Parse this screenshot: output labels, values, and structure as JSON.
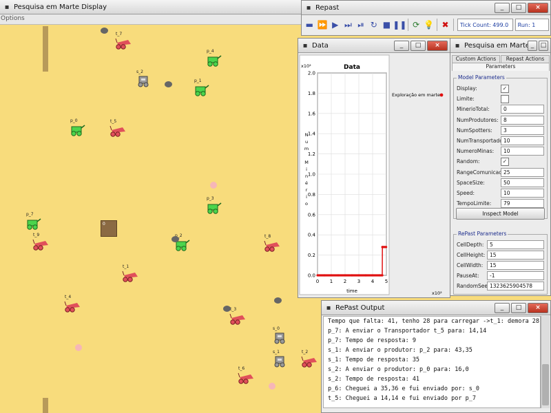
{
  "display": {
    "title": "Pesquisa em Marte Display",
    "menu_options": "Options",
    "agents": [
      {
        "label": "t_7",
        "kind": "transporter"
      },
      {
        "label": "s_2",
        "kind": "spotter"
      },
      {
        "label": "p_4",
        "kind": "producer"
      },
      {
        "label": "p_1",
        "kind": "producer"
      },
      {
        "label": "p_0",
        "kind": "producer"
      },
      {
        "label": "t_5",
        "kind": "transporter"
      },
      {
        "label": "p_3",
        "kind": "producer"
      },
      {
        "label": "p_7",
        "kind": "producer"
      },
      {
        "label": "t_9",
        "kind": "transporter"
      },
      {
        "label": "p_2",
        "kind": "producer"
      },
      {
        "label": "t_8",
        "kind": "transporter"
      },
      {
        "label": "t_1",
        "kind": "transporter"
      },
      {
        "label": "t_4",
        "kind": "transporter"
      },
      {
        "label": "t_3",
        "kind": "transporter"
      },
      {
        "label": "s_0",
        "kind": "spotter"
      },
      {
        "label": "s_1",
        "kind": "spotter"
      },
      {
        "label": "t_2",
        "kind": "transporter"
      },
      {
        "label": "t_6",
        "kind": "transporter"
      }
    ],
    "mine_label": "0"
  },
  "repast": {
    "title": "Repast",
    "tick_count": "Tick Count: 499.0",
    "run": "Run: 1"
  },
  "chart_window": {
    "title": "Data"
  },
  "chart_data": {
    "type": "line",
    "title": "Data",
    "xlabel": "time",
    "ylabel": "Num Minério",
    "x_multiplier": "x10²",
    "y_multiplier": "x10²",
    "xlim": [
      0,
      5
    ],
    "ylim": [
      0,
      2.0
    ],
    "x_ticks": [
      "0",
      "1",
      "2",
      "3",
      "4",
      "5"
    ],
    "y_ticks": [
      "0.0",
      "0.2",
      "0.4",
      "0.6",
      "0.8",
      "1.0",
      "1.2",
      "1.4",
      "1.6",
      "1.8",
      "2.0"
    ],
    "series": [
      {
        "name": "Exploração em marte",
        "color": "#e01010",
        "x": [
          0,
          0.5,
          1.0,
          1.5,
          2.0,
          2.5,
          3.0,
          3.5,
          4.0,
          4.5,
          4.7,
          4.71,
          4.98
        ],
        "y": [
          0,
          0,
          0,
          0,
          0,
          0,
          0,
          0,
          0,
          0,
          0,
          0.28,
          0.28
        ]
      }
    ]
  },
  "params_window": {
    "title": "Pesquisa em Marte",
    "tab_custom": "Custom Actions",
    "tab_repast": "Repast Actions",
    "tab_parameters": "Parameters",
    "model_group": "Model Parameters",
    "model_params": [
      {
        "label": "Display:",
        "type": "check",
        "value": "✓"
      },
      {
        "label": "Limite:",
        "type": "check",
        "value": ""
      },
      {
        "label": "MinerioTotal:",
        "type": "text",
        "value": "0"
      },
      {
        "label": "NumProdutores:",
        "type": "text",
        "value": "8"
      },
      {
        "label": "NumSpotters:",
        "type": "text",
        "value": "3"
      },
      {
        "label": "NumTransportadores:",
        "type": "text",
        "value": "10"
      },
      {
        "label": "NumeroMinas:",
        "type": "text",
        "value": "10"
      },
      {
        "label": "Random:",
        "type": "check",
        "value": "✓"
      },
      {
        "label": "RangeComunicacao:",
        "type": "text",
        "value": "25"
      },
      {
        "label": "SpaceSize:",
        "type": "text",
        "value": "50"
      },
      {
        "label": "Speed:",
        "type": "text",
        "value": "10"
      },
      {
        "label": "TempoLimite:",
        "type": "text",
        "value": "79"
      }
    ],
    "inspect_button": "Inspect Model",
    "repast_group": "RePast Parameters",
    "repast_params": [
      {
        "label": "CellDepth:",
        "value": "5"
      },
      {
        "label": "CellHeight:",
        "value": "15"
      },
      {
        "label": "CellWidth:",
        "value": "15"
      },
      {
        "label": "PauseAt:",
        "value": "-1"
      },
      {
        "label": "RandomSeed:",
        "value": "1323625904578"
      }
    ]
  },
  "output_window": {
    "title": "RePast Output",
    "lines": [
      "Tempo que falta: 41, tenho 28 para carregar ->t_1: demora 28",
      "p_7: A enviar o Transportador t_5 para: 14,14",
      "p_7: Tempo de resposta: 9",
      "s_1: A enviar o produtor: p_2 para: 43,35",
      "s_1: Tempo de resposta: 35",
      "s_2: A enviar o produtor: p_0 para: 16,0",
      "s_2: Tempo de resposta: 41",
      "p_6: Cheguei a 35,36 e fui enviado por: s_0",
      "t_5: Cheguei a 14,14 e fui enviado por p_7"
    ]
  },
  "colors": {
    "sand": "#f8dc7c",
    "producer": "#4cd44c",
    "transporter": "#e0505a",
    "spotter": "#9a9a9a"
  }
}
